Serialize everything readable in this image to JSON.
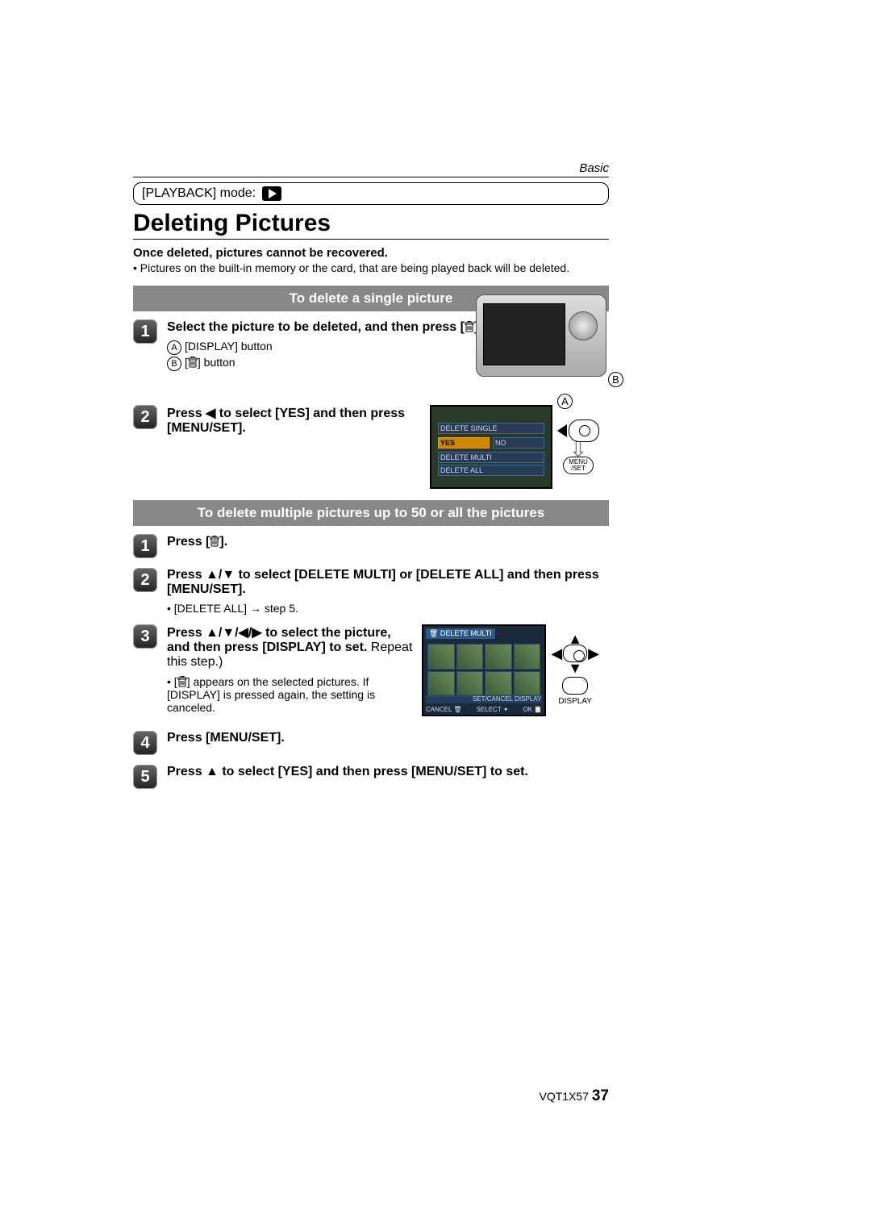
{
  "crumb": "Basic",
  "mode_label": "[PLAYBACK] mode:",
  "title": "Deleting Pictures",
  "warning": "Once deleted, pictures cannot be recovered.",
  "intro_note": "Pictures on the built-in memory or the card, that are being played back will be deleted.",
  "section1": "To delete a single picture",
  "step1_1_a": "Select the picture to be deleted, and then press [",
  "step1_1_b": "].",
  "step1_sub_a": "[DISPLAY] button",
  "step1_sub_b_a": "[",
  "step1_sub_b_b": "] button",
  "callout_A": "A",
  "callout_B": "B",
  "step1_2": "Press ◀ to select [YES] and then press [MENU/SET].",
  "lcd1": {
    "line1": "DELETE SINGLE",
    "yes": "YES",
    "no": "NO",
    "line3": "DELETE MULTI",
    "line4": "DELETE ALL"
  },
  "menuset": "MENU /SET",
  "section2": "To delete multiple pictures up to 50 or all the pictures",
  "step2_1_a": "Press [",
  "step2_1_b": "].",
  "step2_2": "Press ▲/▼ to select [DELETE MULTI] or [DELETE ALL] and then press [MENU/SET].",
  "step2_2_note": "[DELETE ALL] → step 5.",
  "step2_3_bold": "Press ▲/▼/◀/▶ to select the picture, and then press [DISPLAY] to set.",
  "step2_3_plain": " Repeat this step.)",
  "step2_3_note_a": "[",
  "step2_3_note_b": "] appears on the selected pictures. If [DISPLAY] is pressed again, the setting is canceled.",
  "lcd2": {
    "hdr": "🗑 DELETE MULTI",
    "set": "SET/CANCEL DISPLAY",
    "ftr_l": "CANCEL 🗑",
    "ftr_m": "SELECT ✦",
    "ftr_r": "OK 📋"
  },
  "display_label": "DISPLAY",
  "step2_4": "Press [MENU/SET].",
  "step2_5": "Press ▲ to select [YES] and then press [MENU/SET] to set.",
  "doc_code": "VQT1X57",
  "page_num": "37"
}
